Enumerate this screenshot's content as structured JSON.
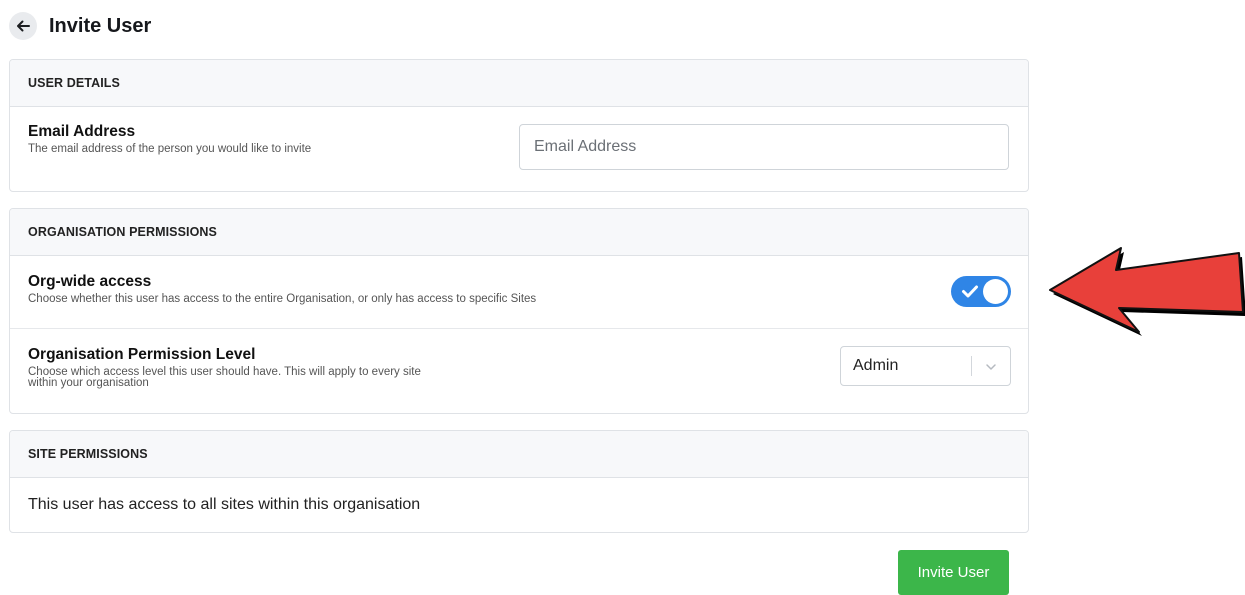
{
  "header": {
    "title": "Invite User",
    "back_icon": "arrow-left-icon"
  },
  "user_details": {
    "section_title": "USER DETAILS",
    "email": {
      "label": "Email Address",
      "description": "The email address of the person you would like to invite",
      "placeholder": "Email Address",
      "value": ""
    }
  },
  "org_permissions": {
    "section_title": "ORGANISATION PERMISSIONS",
    "org_wide": {
      "label": "Org-wide access",
      "description": "Choose whether this user has access to the entire Organisation, or only has access to specific Sites",
      "enabled": true,
      "toggle_color": "#2f85e6"
    },
    "permission_level": {
      "label": "Organisation Permission Level",
      "description_line1": "Choose which access level this user should have. This will apply to every site",
      "description_line2": "within your organisation",
      "selected": "Admin"
    }
  },
  "site_permissions": {
    "section_title": "SITE PERMISSIONS",
    "message": "This user has access to all sites within this organisation"
  },
  "actions": {
    "invite_label": "Invite User",
    "invite_color": "#3cb64a"
  },
  "annotation": {
    "arrow_color": "#e8403a",
    "arrow_direction": "left"
  }
}
